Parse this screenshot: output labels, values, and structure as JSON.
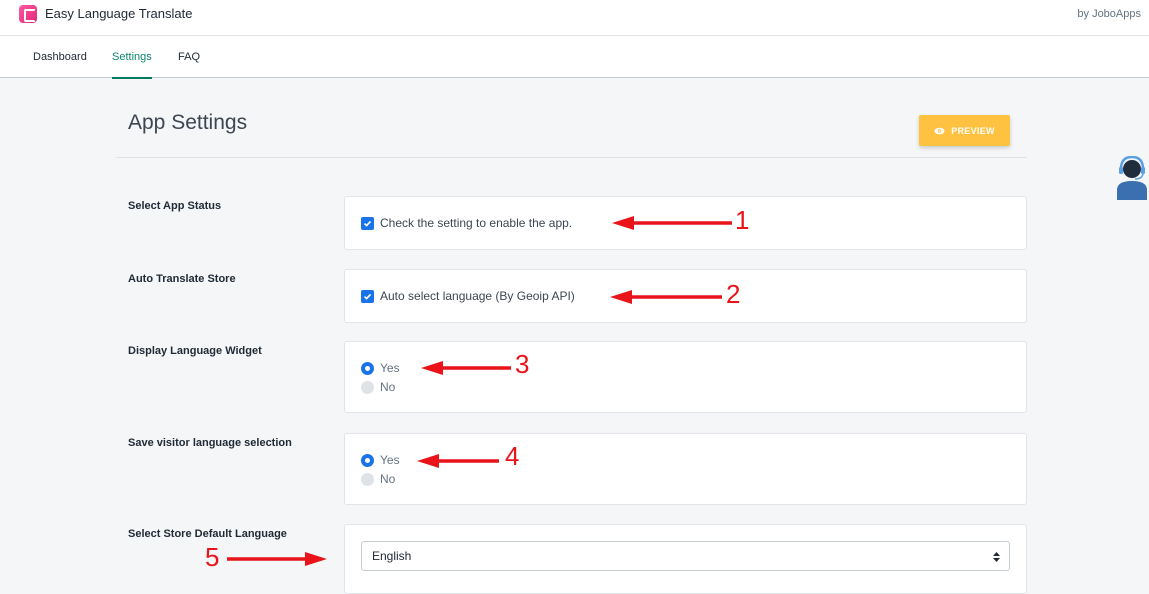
{
  "header": {
    "app_title": "Easy Language Translate",
    "by_label": "by JoboApps"
  },
  "tabs": [
    {
      "label": "Dashboard",
      "active": false
    },
    {
      "label": "Settings",
      "active": true
    },
    {
      "label": "FAQ",
      "active": false
    }
  ],
  "page": {
    "title": "App Settings",
    "preview_label": "PREVIEW"
  },
  "settings": {
    "app_status": {
      "label": "Select App Status",
      "checkbox_label": "Check the setting to enable the app.",
      "checked": true
    },
    "auto_translate": {
      "label": "Auto Translate Store",
      "checkbox_label": "Auto select language (By Geoip API)",
      "checked": true
    },
    "display_widget": {
      "label": "Display Language Widget",
      "options": [
        "Yes",
        "No"
      ],
      "selected": "Yes"
    },
    "save_selection": {
      "label": "Save visitor language selection",
      "options": [
        "Yes",
        "No"
      ],
      "selected": "Yes"
    },
    "default_language": {
      "label": "Select Store Default Language",
      "selected": "English"
    }
  },
  "annotations": [
    "1",
    "2",
    "3",
    "4",
    "5"
  ],
  "colors": {
    "accent_green": "#007a5e",
    "preview_yellow": "#ffc240",
    "control_blue": "#1a73e8",
    "annotation_red": "#e8141a"
  },
  "icons": {
    "logo": "app-logo-icon",
    "preview": "eye-icon",
    "support": "support-agent-icon",
    "select": "sort-arrows-icon"
  }
}
